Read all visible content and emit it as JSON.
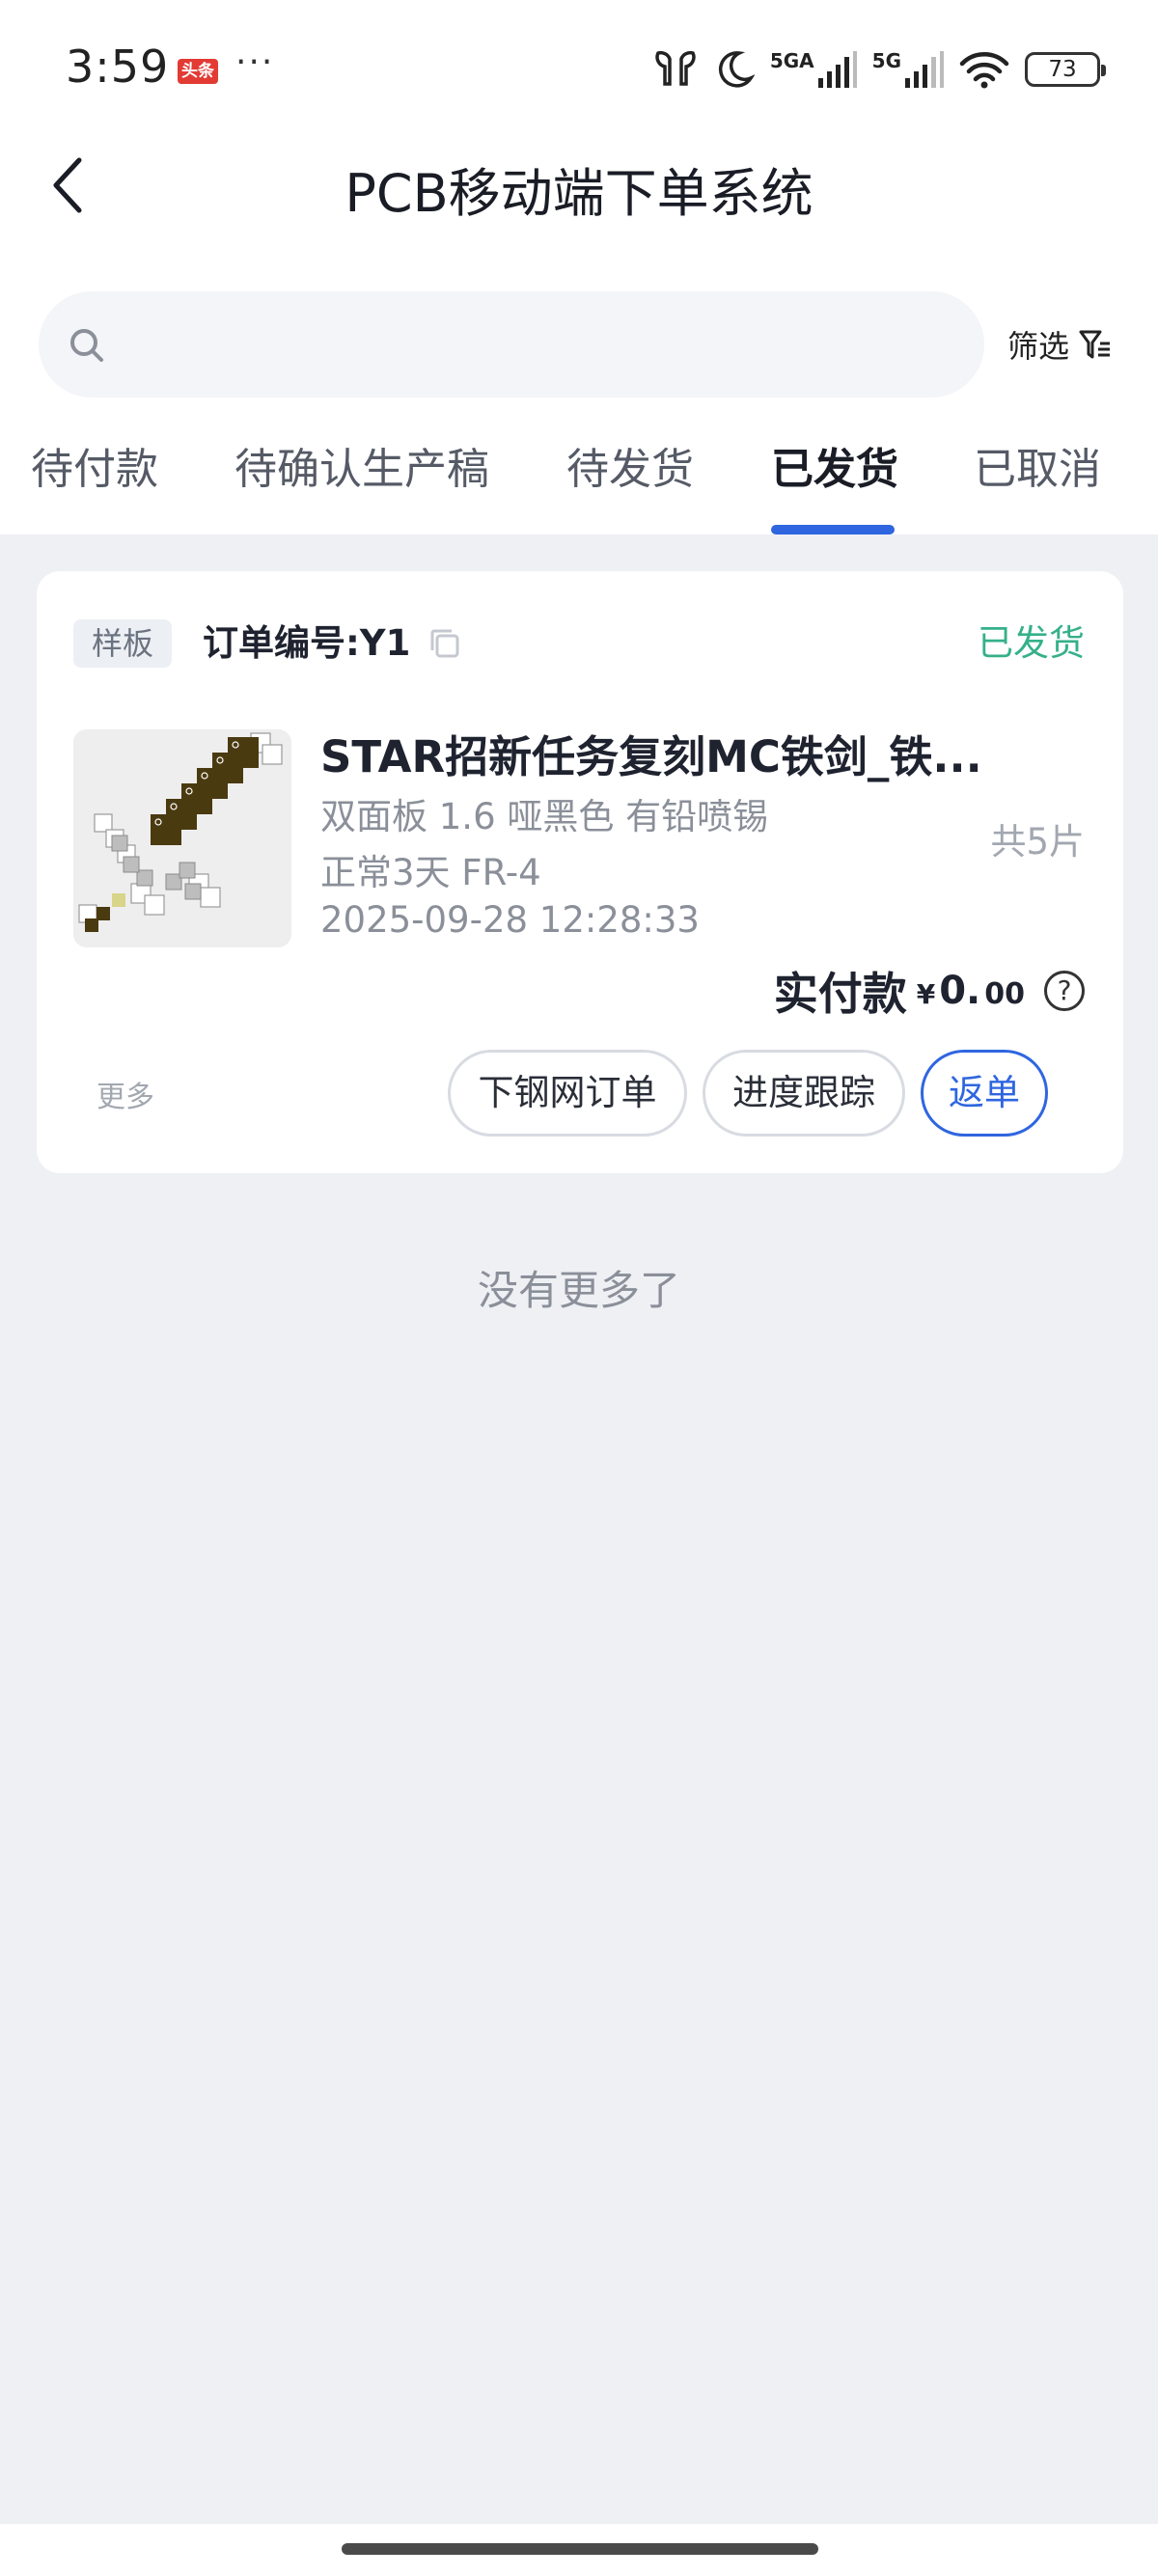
{
  "status_bar": {
    "time": "3:59",
    "news_badge": "头条",
    "more_dots": "···",
    "network_1": "5GA",
    "network_2": "5G",
    "battery": "73"
  },
  "header": {
    "title": "PCB移动端下单系统"
  },
  "search": {
    "placeholder": "",
    "filter_label": "筛选"
  },
  "tabs": [
    {
      "label": "待付款"
    },
    {
      "label": "待确认生产稿"
    },
    {
      "label": "待发货"
    },
    {
      "label": "已发货"
    },
    {
      "label": "已取消"
    }
  ],
  "active_tab": "已发货",
  "order": {
    "tag": "样板",
    "order_no": "订单编号:Y1",
    "status": "已发货",
    "status_color": "#35b08a",
    "product_title": "STAR招新任务复刻MC铁剑_铁...",
    "spec_1": "双面板 1.6 哑黑色 有铅喷锡",
    "spec_2": "正常3天 FR-4",
    "datetime": "2025-09-28 12:28:33",
    "quantity": "共5片",
    "paid_label": "实付款",
    "currency": "¥",
    "amount_int": "0.",
    "amount_dec": "00",
    "help": "?",
    "more": "更多",
    "buttons": {
      "stencil": "下钢网订单",
      "tracking": "进度跟踪",
      "reorder": "返单"
    }
  },
  "footer_text": "没有更多了",
  "accent_color": "#2f66e0"
}
